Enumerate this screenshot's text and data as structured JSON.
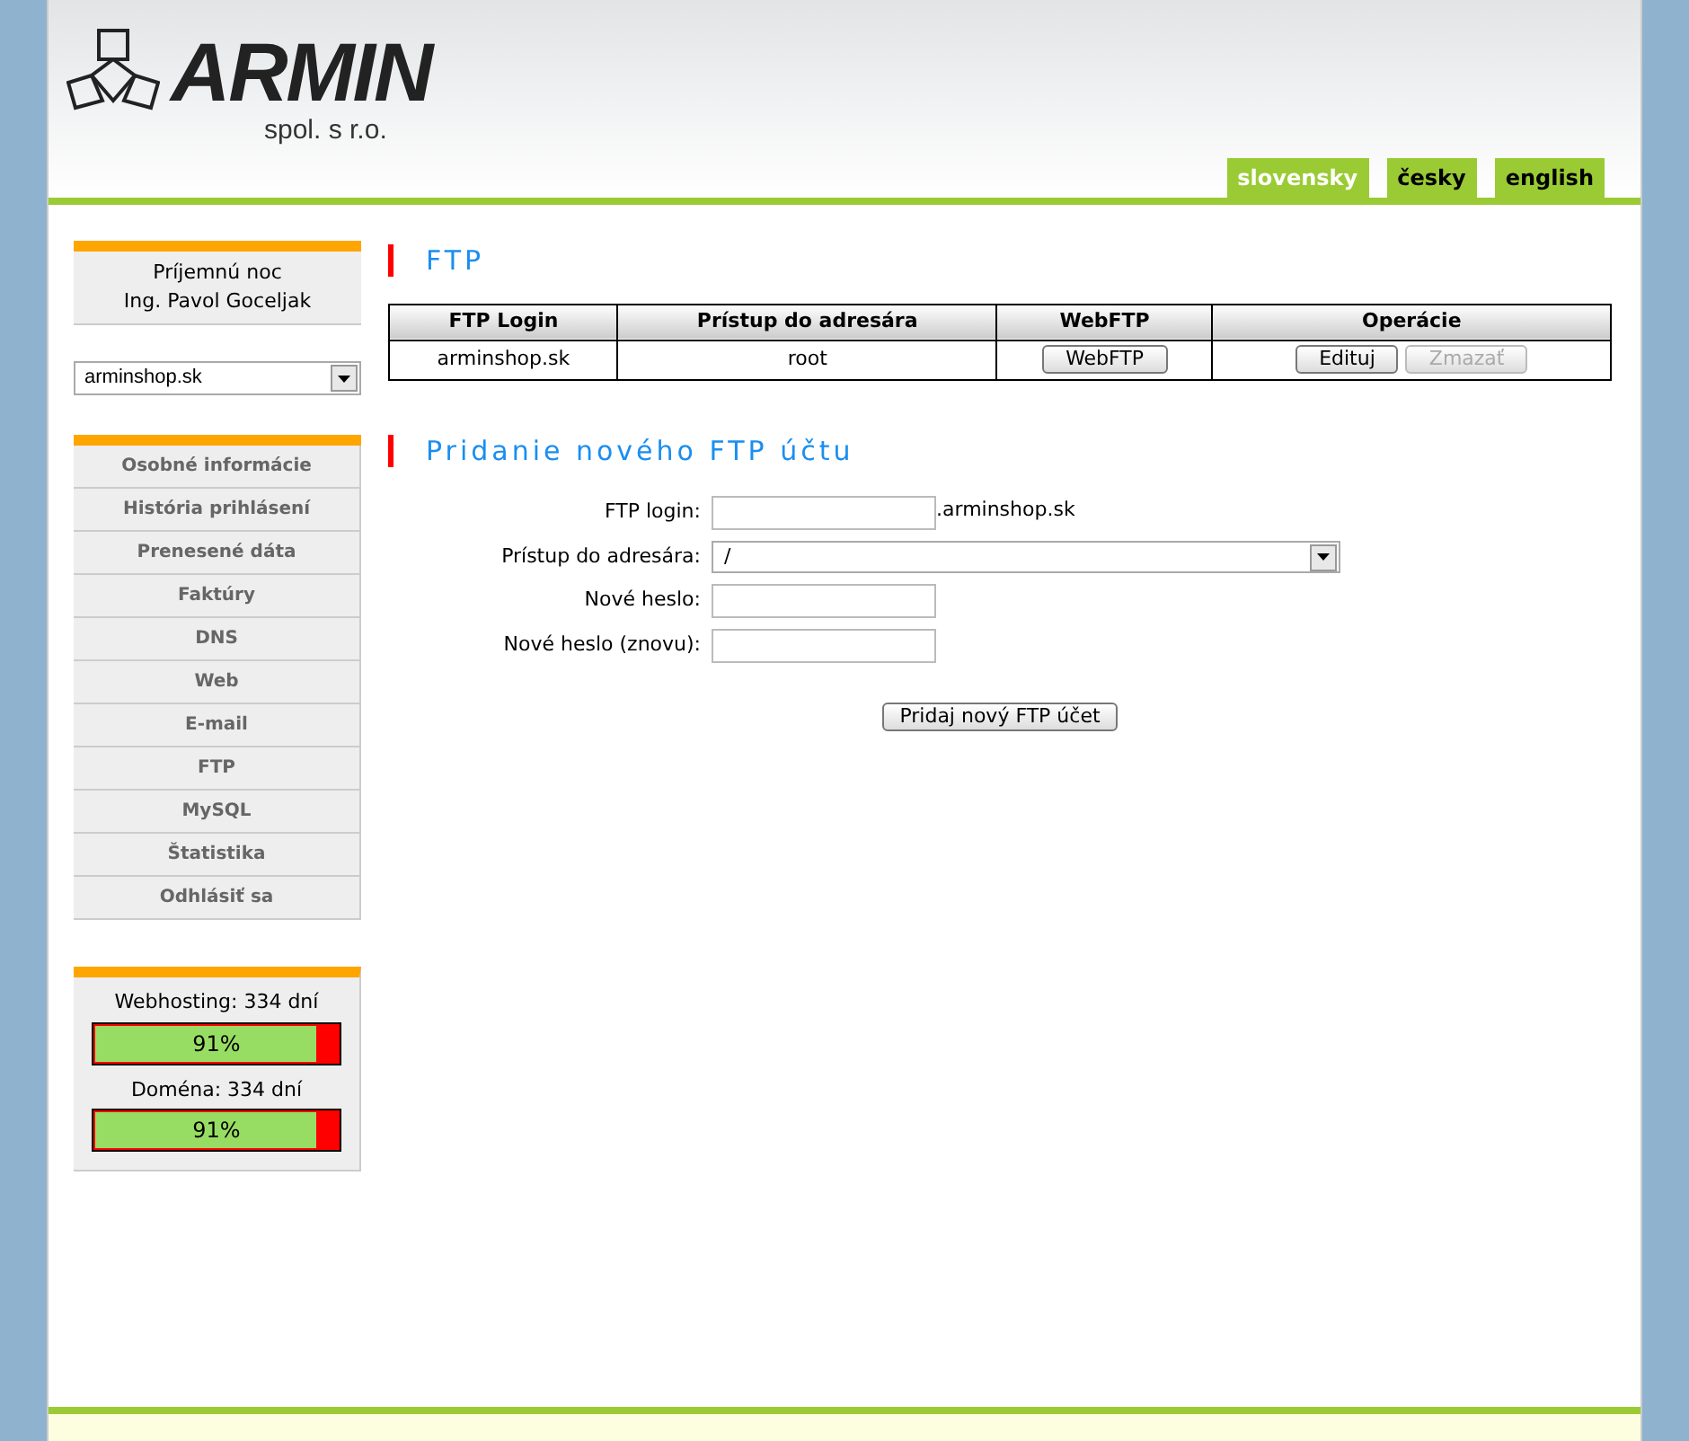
{
  "header": {
    "logo": "ARMIN",
    "company": "spol. s r.o."
  },
  "languages": [
    {
      "label": "slovensky",
      "selected": true
    },
    {
      "label": "česky",
      "selected": false
    },
    {
      "label": "english",
      "selected": false
    }
  ],
  "sidebar": {
    "greeting": [
      "Príjemnú noc",
      "Ing. Pavol Goceljak"
    ],
    "domain_select": {
      "value": "arminshop.sk"
    },
    "menu": [
      "Osobné informácie",
      "História prihlásení",
      "Prenesené dáta",
      "Faktúry",
      "DNS",
      "Web",
      "E-mail",
      "FTP",
      "MySQL",
      "Štatistika",
      "Odhlásiť sa"
    ],
    "meters": [
      {
        "label": "Webhosting: 334 dní",
        "level": 0.91,
        "reading": "91%"
      },
      {
        "label": "Doména: 334 dní",
        "level": 0.91,
        "reading": "91%"
      }
    ]
  },
  "ftp": {
    "title": "FTP",
    "columns": [
      "FTP Login",
      "Prístup do adresára",
      "WebFTP",
      "Operácie"
    ],
    "rows": [
      {
        "login": "arminshop.sk",
        "directory": "root",
        "webftp_button": "WebFTP",
        "actions": [
          {
            "label": "Edituj",
            "disabled": false
          },
          {
            "label": "Zmazať",
            "disabled": true
          }
        ]
      }
    ]
  },
  "new_account": {
    "title": "Pridanie nového FTP účtu",
    "fields": [
      {
        "kind": "text",
        "label": "FTP login:",
        "suffix": ".arminshop.sk"
      },
      {
        "kind": "select",
        "label": "Prístup do adresára:",
        "value": "/"
      },
      {
        "kind": "text",
        "label": "Nové heslo:"
      },
      {
        "kind": "text",
        "label": "Nové heslo (znovu):"
      }
    ],
    "submit": "Pridaj nový FTP účet"
  }
}
